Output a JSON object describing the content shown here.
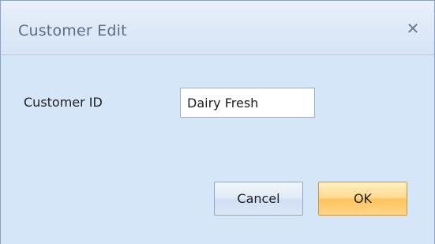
{
  "window": {
    "title": "Customer Edit",
    "close_glyph": "✕",
    "close_icon": "close-icon"
  },
  "form": {
    "customer_id_label": "Customer ID",
    "customer_id_value": "Dairy Fresh"
  },
  "buttons": {
    "cancel_label": "Cancel",
    "ok_label": "OK"
  },
  "colors": {
    "dialog_background": "#d6e6f9",
    "ok_button_accent": "#ffc45a"
  }
}
